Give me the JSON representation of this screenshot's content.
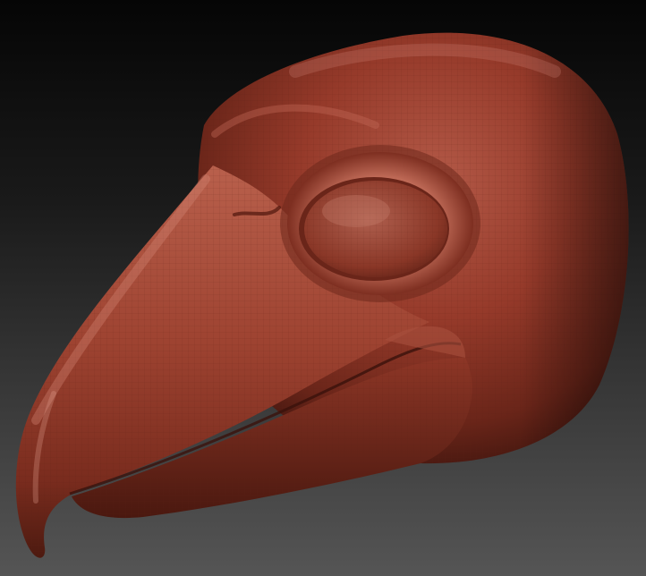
{
  "scene": {
    "subject": "sculpted-bird-head-mesh",
    "colors": {
      "background_top": "#050505",
      "background_bottom": "#555555",
      "clay_base": "#8e3526",
      "clay_highlight": "#c8705e",
      "clay_shadow": "#3d140d",
      "wire": "#5a2016"
    }
  }
}
